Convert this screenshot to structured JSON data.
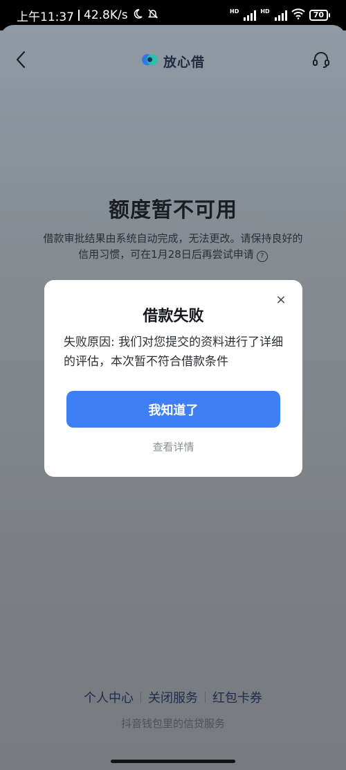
{
  "status_bar": {
    "time": "上午11:37",
    "net_speed": "42.8K/s",
    "battery": "70",
    "hd_label": "HD"
  },
  "nav": {
    "brand": "放心借",
    "back_icon": "chevron-left-icon",
    "support_icon": "headset-icon"
  },
  "main": {
    "title": "额度暂不可用",
    "subtitle_line1": "借款审批结果由系统自动完成，无法更改。请保持良好的",
    "subtitle_line2": "信用习惯，可在1月28日后再尝试申请",
    "help_glyph": "?"
  },
  "modal": {
    "title": "借款失败",
    "message": "失败原因: 我们对您提交的资料进行了详细的评估，本次暂不符合借款条件",
    "primary_button": "我知道了",
    "detail_link": "查看详情",
    "close_glyph": "×"
  },
  "footer": {
    "links": [
      "个人中心",
      "关闭服务",
      "红包卡券"
    ],
    "note": "抖音钱包里的信贷服务"
  },
  "colors": {
    "primary": "#3e7ff5",
    "brand_text": "#1e2b44"
  }
}
